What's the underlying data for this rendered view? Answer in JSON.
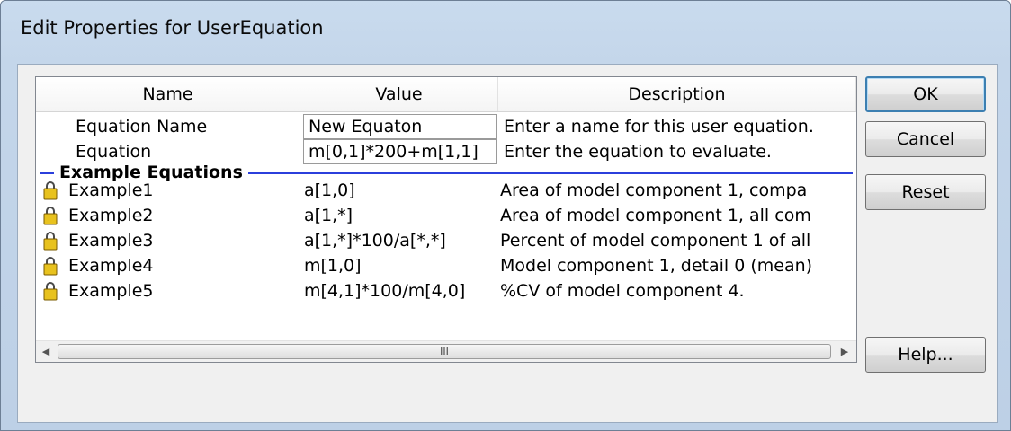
{
  "window": {
    "title": "Edit Properties for UserEquation"
  },
  "grid": {
    "columns": [
      "Name",
      "Value",
      "Description"
    ],
    "editable_rows": [
      {
        "name": "Equation Name",
        "value": "New Equaton",
        "description": "Enter a name for this user equation."
      },
      {
        "name": "Equation",
        "value": "m[0,1]*200+m[1,1]",
        "description": "Enter the equation to evaluate."
      }
    ],
    "section_label": "Example Equations",
    "example_rows": [
      {
        "name": "Example1",
        "value": "a[1,0]",
        "description": "Area of model component 1, compa"
      },
      {
        "name": "Example2",
        "value": "a[1,*]",
        "description": "Area of model component 1, all com"
      },
      {
        "name": "Example3",
        "value": "a[1,*]*100/a[*,*]",
        "description": "Percent of model component 1 of all"
      },
      {
        "name": "Example4",
        "value": "m[1,0]",
        "description": "Model component 1, detail 0 (mean)"
      },
      {
        "name": "Example5",
        "value": "m[4,1]*100/m[4,0]",
        "description": "%CV of model component 4."
      }
    ],
    "scrollbar": {
      "grip": "III"
    }
  },
  "buttons": {
    "ok": "OK",
    "cancel": "Cancel",
    "reset": "Reset",
    "help": "Help..."
  },
  "colors": {
    "section_line": "#2b3fdc",
    "default_button_border": "#3c7fb1",
    "lock_icon": "#e8c21e"
  }
}
